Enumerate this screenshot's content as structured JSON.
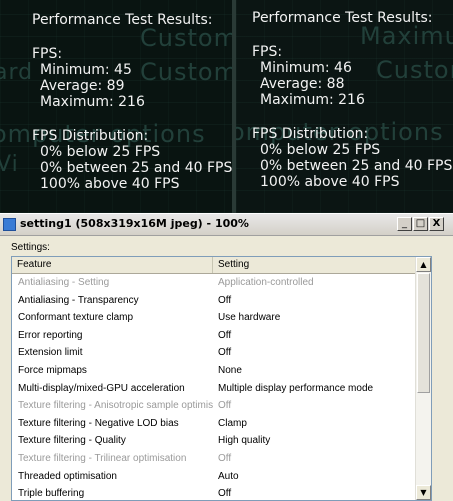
{
  "top_left": {
    "heading": "Performance Test Results:",
    "fps_label": "FPS:",
    "minimum": "Minimum:  45",
    "average": "Average:   89",
    "maximum": "Maximum:  216",
    "dist_label": "FPS Distribution:",
    "below": "0% below 25 FPS",
    "between": "0% between 25 and 40 FPS",
    "above": "100% above 40 FPS",
    "bg_words": [
      "Custom",
      "Custom",
      "omputer options",
      "Vi"
    ]
  },
  "top_right": {
    "heading": "Performance Test Results:",
    "fps_label": "FPS:",
    "minimum": "Minimum:  46",
    "average": "Average:   88",
    "maximum": "Maximum:  216",
    "dist_label": "FPS Distribution:",
    "below": "0% below 25 FPS",
    "between": "0% between 25 and 40 FPS",
    "above": "100% above 40 FPS",
    "bg_words": [
      "Maximum",
      "Custom",
      "omputer options"
    ]
  },
  "window": {
    "title": "setting1 (508x319x16M jpeg) - 100%",
    "minimize": "_",
    "maximize": "□",
    "close": "X",
    "settings_label": "Settings:",
    "columns": [
      "Feature",
      "Setting"
    ],
    "rows": [
      {
        "feature": "Antialiasing - Setting",
        "setting": "Application-controlled",
        "disabled": true
      },
      {
        "feature": "Antialiasing - Transparency",
        "setting": "Off",
        "disabled": false
      },
      {
        "feature": "Conformant texture clamp",
        "setting": "Use hardware",
        "disabled": false
      },
      {
        "feature": "Error reporting",
        "setting": "Off",
        "disabled": false
      },
      {
        "feature": "Extension limit",
        "setting": "Off",
        "disabled": false
      },
      {
        "feature": "Force mipmaps",
        "setting": "None",
        "disabled": false
      },
      {
        "feature": "Multi-display/mixed-GPU acceleration",
        "setting": "Multiple display performance mode",
        "disabled": false
      },
      {
        "feature": "Texture filtering - Anisotropic sample optimis...",
        "setting": "Off",
        "disabled": true
      },
      {
        "feature": "Texture filtering - Negative LOD bias",
        "setting": "Clamp",
        "disabled": false
      },
      {
        "feature": "Texture filtering - Quality",
        "setting": "High quality",
        "disabled": false
      },
      {
        "feature": "Texture filtering - Trilinear optimisation",
        "setting": "Off",
        "disabled": true
      },
      {
        "feature": "Threaded optimisation",
        "setting": "Auto",
        "disabled": false
      },
      {
        "feature": "Triple buffering",
        "setting": "Off",
        "disabled": false
      }
    ],
    "scroll_up": "▲",
    "scroll_down": "▼"
  }
}
